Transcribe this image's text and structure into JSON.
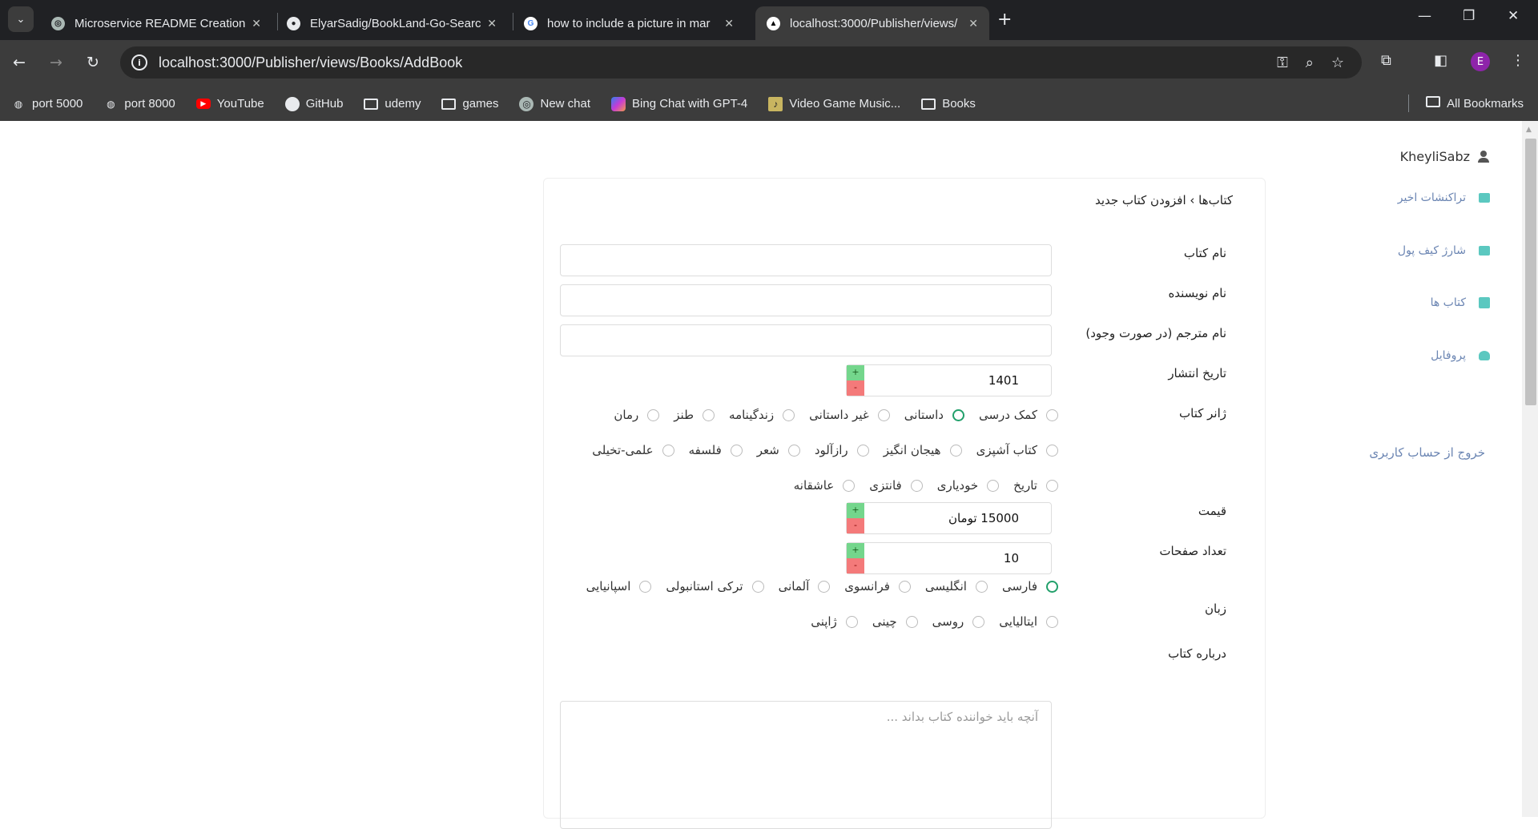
{
  "browser": {
    "tabs": [
      {
        "title": "Microservice README Creation",
        "favicon": "chatgpt-icon"
      },
      {
        "title": "ElyarSadig/BookLand-Go-Searc",
        "favicon": "github-icon"
      },
      {
        "title": "how to include a picture in mar",
        "favicon": "google-icon"
      },
      {
        "title": "localhost:3000/Publisher/views/",
        "favicon": "nextjs-icon"
      }
    ],
    "url": "localhost:3000/Publisher/views/Books/AddBook",
    "profile_initial": "E",
    "bookmarks": [
      {
        "label": "port 5000",
        "icon": "globe-icon"
      },
      {
        "label": "port 8000",
        "icon": "globe-icon"
      },
      {
        "label": "YouTube",
        "icon": "youtube-icon"
      },
      {
        "label": "GitHub",
        "icon": "github-icon"
      },
      {
        "label": "udemy",
        "icon": "folder-icon"
      },
      {
        "label": "games",
        "icon": "folder-icon"
      },
      {
        "label": "New chat",
        "icon": "chatgpt-icon"
      },
      {
        "label": "Bing Chat with GPT-4",
        "icon": "copilot-icon"
      },
      {
        "label": "Video Game Music...",
        "icon": "music-icon"
      },
      {
        "label": "Books",
        "icon": "folder-icon"
      }
    ],
    "all_bookmarks": "All Bookmarks"
  },
  "sidebar": {
    "username": "KheyliSabz",
    "items": [
      {
        "label": "تراکنشات اخیر",
        "icon": "card-icon"
      },
      {
        "label": "شارژ کیف پول",
        "icon": "card-icon"
      },
      {
        "label": "کتاب ها",
        "icon": "book-icon"
      },
      {
        "label": "پروفایل",
        "icon": "user-icon"
      }
    ],
    "logout": "خروج از حساب کاربری"
  },
  "form": {
    "breadcrumb": "کتاب‌ها › افزودن کتاب جدید",
    "labels": {
      "title": "نام کتاب",
      "author": "نام نویسنده",
      "translator": "نام مترجم (در صورت وجود)",
      "pub_date": "تاریخ انتشار",
      "genre": "ژانر کتاب",
      "price": "قیمت",
      "pages": "تعداد صفحات",
      "language": "زبان",
      "about": "درباره کتاب"
    },
    "values": {
      "title": "",
      "author": "",
      "translator": "",
      "pub_date": "1401",
      "price": "15000 تومان",
      "pages": "10"
    },
    "about_placeholder": "آنچه باید خواننده کتاب بداند ...",
    "stepper": {
      "plus": "+",
      "minus": "-"
    },
    "genres": [
      [
        {
          "label": "کمک درسی",
          "selected": false
        },
        {
          "label": "داستانی",
          "selected": true
        },
        {
          "label": "غیر داستانی",
          "selected": false
        },
        {
          "label": "زندگینامه",
          "selected": false
        },
        {
          "label": "طنز",
          "selected": false
        },
        {
          "label": "رمان",
          "selected": false
        }
      ],
      [
        {
          "label": "کتاب آشپزی",
          "selected": false
        },
        {
          "label": "هیجان انگیز",
          "selected": false
        },
        {
          "label": "رازآلود",
          "selected": false
        },
        {
          "label": "شعر",
          "selected": false
        },
        {
          "label": "فلسفه",
          "selected": false
        },
        {
          "label": "علمی-تخیلی",
          "selected": false
        }
      ],
      [
        {
          "label": "تاریخ",
          "selected": false
        },
        {
          "label": "خودیاری",
          "selected": false
        },
        {
          "label": "فانتزی",
          "selected": false
        },
        {
          "label": "عاشقانه",
          "selected": false
        }
      ]
    ],
    "languages": [
      [
        {
          "label": "فارسی",
          "selected": true
        },
        {
          "label": "انگلیسی",
          "selected": false
        },
        {
          "label": "فرانسوی",
          "selected": false
        },
        {
          "label": "آلمانی",
          "selected": false
        },
        {
          "label": "ترکی استانبولی",
          "selected": false
        },
        {
          "label": "اسپانیایی",
          "selected": false
        }
      ],
      [
        {
          "label": "ایتالیایی",
          "selected": false
        },
        {
          "label": "روسی",
          "selected": false
        },
        {
          "label": "چینی",
          "selected": false
        },
        {
          "label": "ژاپنی",
          "selected": false
        }
      ]
    ]
  }
}
